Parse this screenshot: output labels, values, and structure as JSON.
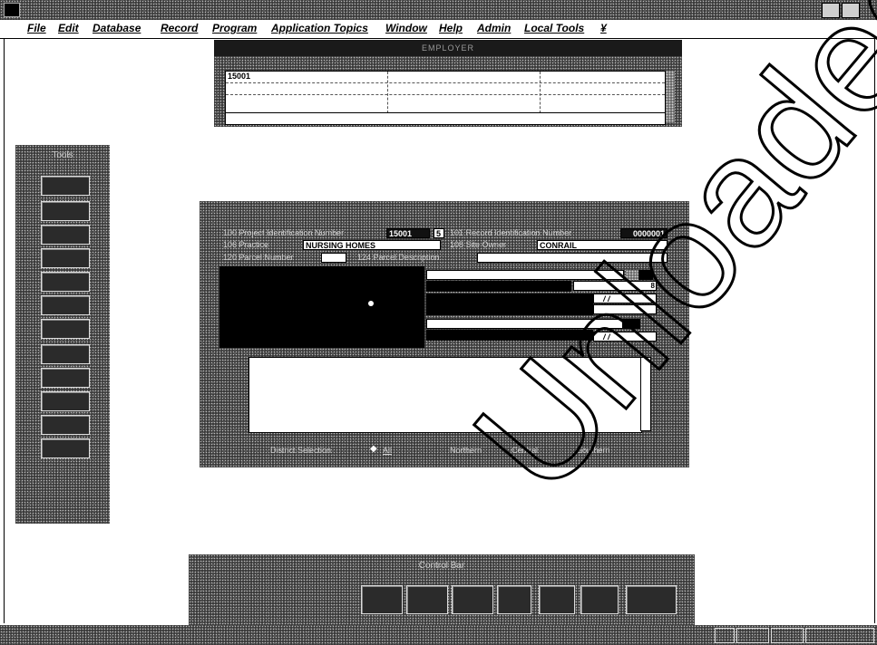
{
  "menu": {
    "items": [
      "File",
      "Edit",
      "Database",
      "Record",
      "Program",
      "Application Topics",
      "Window",
      "Help",
      "Admin",
      "Local Tools",
      "¥"
    ]
  },
  "employer": {
    "title": "EMPLOYER",
    "first_value": "15001"
  },
  "tools": {
    "title": "Tools"
  },
  "dialog": {
    "project_id_label": "100 Project Identification Number",
    "project_id_value": "15001",
    "project_id_suffix": "5",
    "record_id_label": "101 Record Identification Number",
    "record_id_value": "0000001",
    "practice_label": "106 Practice",
    "practice_value": "NURSING HOMES",
    "site_owner_label": "108 Site Owner",
    "site_owner_value": "CONRAIL",
    "parcel_label": "120 Parcel Number",
    "parcel_value": "",
    "parcel_desc_label": "124 Parcel Description",
    "parcel_desc_value": "",
    "date_placeholder": "/ /",
    "district_label": "District Selection",
    "districts": [
      "All",
      "Northern",
      "Central",
      "Southern"
    ],
    "selected_district": "All"
  },
  "control_bar": {
    "title": "Control Bar"
  },
  "watermark": "Unloaded"
}
